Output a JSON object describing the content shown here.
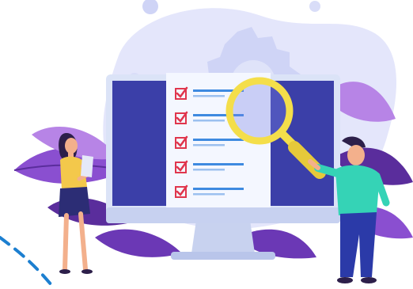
{
  "illustration": {
    "checklist_items": [
      {
        "checked": true
      },
      {
        "checked": true
      },
      {
        "checked": true
      },
      {
        "checked": true
      },
      {
        "checked": true
      }
    ],
    "colors": {
      "background_blob": "#e4e6fb",
      "gear": "#cfd4f6",
      "leaves_dark": "#5a2d9c",
      "leaves_mid": "#8a4fd0",
      "leaves_light": "#b784e6",
      "monitor_frame": "#dbe3f7",
      "monitor_dark_panel": "#3b3fa8",
      "monitor_stand": "#c8d2ef",
      "checklist_bg": "#f4f7ff",
      "check_red": "#e0364d",
      "line_blue": "#3e8ae0",
      "magnifier_yellow": "#f4de4a",
      "woman_shirt": "#f3c84b",
      "woman_skirt": "#2c2d75",
      "man_shirt": "#35d3b6",
      "man_pants": "#2b3aa8",
      "dashed_line": "#1c7fd0"
    }
  }
}
